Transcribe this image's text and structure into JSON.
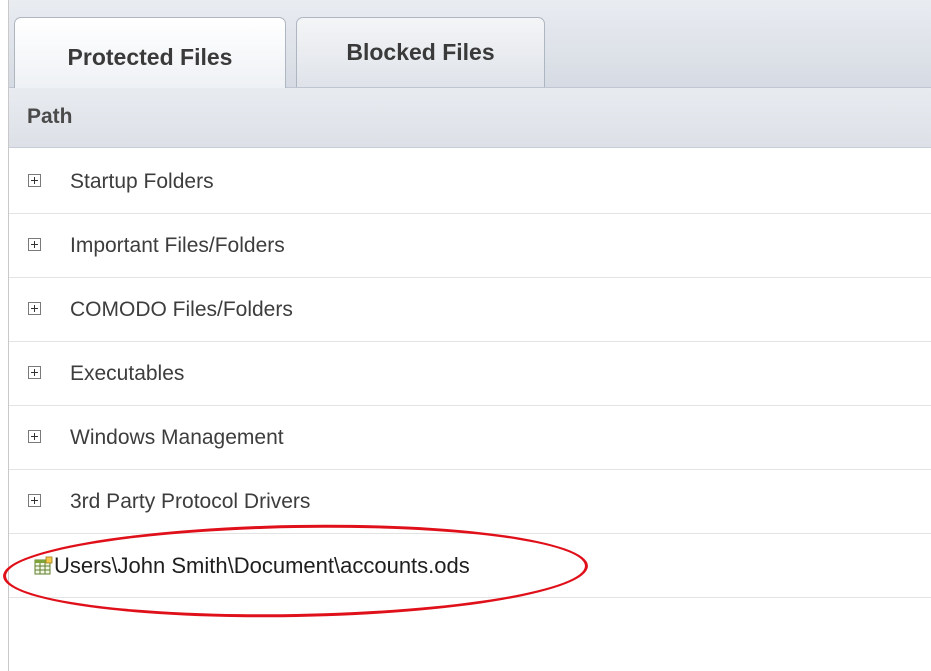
{
  "tabs": [
    {
      "label": "Protected Files",
      "active": true
    },
    {
      "label": "Blocked Files",
      "active": false
    }
  ],
  "table": {
    "column_header": "Path",
    "groups": [
      {
        "label": "Startup Folders",
        "icon": "expand-plus-icon"
      },
      {
        "label": "Important Files/Folders",
        "icon": "expand-plus-icon"
      },
      {
        "label": "COMODO Files/Folders",
        "icon": "expand-plus-icon"
      },
      {
        "label": "Executables",
        "icon": "expand-plus-icon"
      },
      {
        "label": "Windows Management",
        "icon": "expand-plus-icon"
      },
      {
        "label": "3rd Party Protocol Drivers",
        "icon": "expand-plus-icon"
      }
    ],
    "file_entry": {
      "label": "Users\\John Smith\\Document\\accounts.ods",
      "icon": "spreadsheet-file-icon"
    }
  },
  "colors": {
    "highlight": "#e0101a"
  }
}
